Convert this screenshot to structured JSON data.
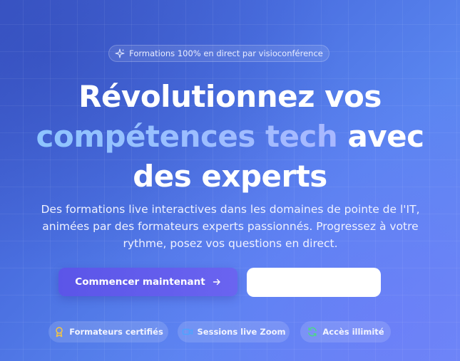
{
  "badge": {
    "icon": "sparkles-icon",
    "text": "Formations 100% en direct par visioconférence"
  },
  "hero": {
    "line1": "Révolutionnez vos",
    "line2_highlight": "compétences tech",
    "line2_rest": " avec",
    "line3": "des experts",
    "highlight_color": "#8ec5ff"
  },
  "subtitle": "Des formations live interactives dans les domaines de pointe de l'IT, animées par des formateurs experts passionnés. Progressez à votre rythme, posez vos questions en direct.",
  "cta": {
    "primary_label": "Commencer maintenant",
    "primary_icon": "arrow-right-icon",
    "primary_color": "#5b55e8",
    "secondary_label": ""
  },
  "features": [
    {
      "label": "Formateurs certifiés",
      "icon": "award-icon",
      "icon_color": "#f5c542"
    },
    {
      "label": "Sessions live Zoom",
      "icon": "video-icon",
      "icon_color": "#4da3ff"
    },
    {
      "label": "Accès illimité",
      "icon": "refresh-icon",
      "icon_color": "#4cd68a"
    }
  ]
}
